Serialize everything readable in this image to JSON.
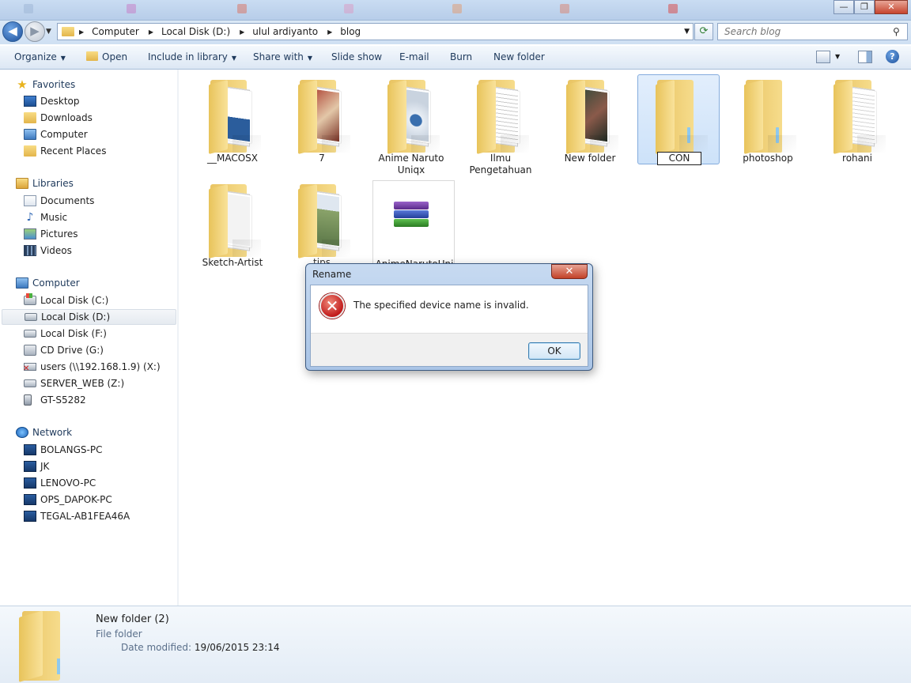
{
  "window": {
    "close_glyph": "✕",
    "minimize_glyph": "—",
    "restore_glyph": "❐"
  },
  "address": {
    "crumbs": [
      "Computer",
      "Local Disk (D:)",
      "ulul ardiyanto",
      "blog"
    ],
    "search_placeholder": "Search blog"
  },
  "toolbar": {
    "organize": "Organize",
    "open": "Open",
    "include": "Include in library",
    "share": "Share with",
    "slideshow": "Slide show",
    "email": "E-mail",
    "burn": "Burn",
    "new_folder": "New folder"
  },
  "nav": {
    "favorites": {
      "label": "Favorites",
      "items": [
        "Desktop",
        "Downloads",
        "Computer",
        "Recent Places"
      ]
    },
    "libraries": {
      "label": "Libraries",
      "items": [
        "Documents",
        "Music",
        "Pictures",
        "Videos"
      ]
    },
    "computer": {
      "label": "Computer",
      "items": [
        "Local Disk (C:)",
        "Local Disk (D:)",
        "Local Disk (F:)",
        "CD Drive (G:)",
        "users (\\\\192.168.1.9) (X:)",
        "SERVER_WEB (Z:)",
        "GT-S5282"
      ]
    },
    "network": {
      "label": "Network",
      "items": [
        "BOLANGS-PC",
        "JK",
        "LENOVO-PC",
        "OPS_DAPOK-PC",
        "TEGAL-AB1FEA46A"
      ]
    }
  },
  "files": [
    {
      "name": "__MACOSX"
    },
    {
      "name": "7"
    },
    {
      "name": "Anime Naruto Uniqx"
    },
    {
      "name": "Ilmu Pengetahuan"
    },
    {
      "name": "New folder"
    },
    {
      "name": "CON"
    },
    {
      "name": "photoshop"
    },
    {
      "name": "rohani"
    },
    {
      "name": "Sketch-Artist"
    },
    {
      "name": "tips"
    },
    {
      "name": "AnimeNarutoUni"
    }
  ],
  "details": {
    "name": "New folder (2)",
    "type": "File folder",
    "modified_label": "Date modified:",
    "modified_value": "19/06/2015 23:14"
  },
  "dialog": {
    "title": "Rename",
    "message": "The specified device name is invalid.",
    "ok": "OK",
    "close_glyph": "✕",
    "error_glyph": "✕"
  },
  "colors": {
    "accent": "#1c4f9a",
    "selection": "#cde2f9",
    "error": "#c11b1b"
  }
}
